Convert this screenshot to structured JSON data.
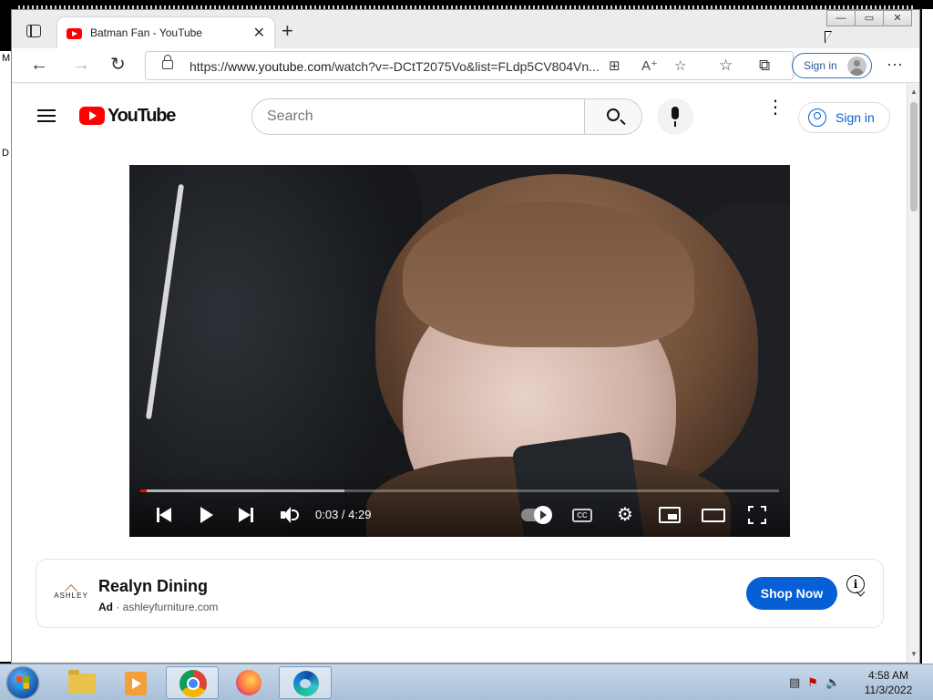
{
  "browser": {
    "tab_title": "Batman Fan - YouTube",
    "tab_close": "✕",
    "new_tab": "+",
    "url_prefix": "https://",
    "url_main": "www.youtube.com",
    "url_rest": "/watch?v=-DCtT2075Vo&list=FLdp5CV804Vn...",
    "sign_in": "Sign in",
    "more": "···",
    "window_controls": [
      "—",
      "▭",
      "✕"
    ]
  },
  "youtube": {
    "logo_text": "YouTube",
    "search_placeholder": "Search",
    "sign_in": "Sign in",
    "more": "⋮"
  },
  "player": {
    "time": "0:03 / 4:29",
    "cc": "CC",
    "progress_played": 0.006,
    "progress_buffered": 0.32
  },
  "ad": {
    "brand": "ASHLEY",
    "title": "Realyn Dining",
    "label": "Ad",
    "domain": " · ashleyfurniture.com",
    "cta": "Shop Now",
    "info": "i"
  },
  "desktop": {
    "left_letters": [
      "M",
      "D"
    ]
  },
  "taskbar": {
    "time": "4:58 AM",
    "date": "11/3/2022"
  },
  "colors": {
    "youtube_red": "#ff0000",
    "accent_blue": "#065fd4",
    "taskbar": "#b8cde2"
  }
}
